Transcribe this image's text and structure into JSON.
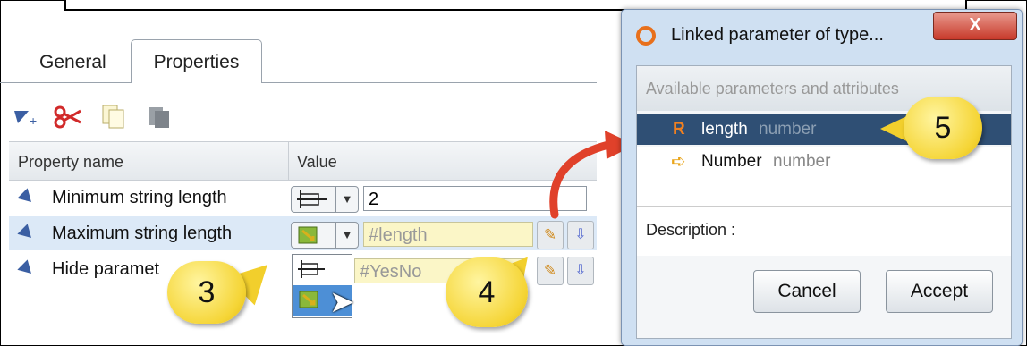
{
  "tabs": [
    {
      "label": "General"
    },
    {
      "label": "Properties"
    }
  ],
  "table": {
    "header_name": "Property name",
    "header_value": "Value",
    "rows": [
      {
        "name": "Minimum string length",
        "value": "2"
      },
      {
        "name": "Maximum string length",
        "value": "#length"
      },
      {
        "name": "Hide paramet",
        "value": "#YesNo"
      }
    ]
  },
  "callouts": {
    "three": "3",
    "four": "4",
    "five": "5"
  },
  "dialog": {
    "title": "Linked parameter of type...",
    "close_label": "X",
    "list_header": "Available parameters and attributes",
    "items": [
      {
        "name": "length",
        "type": "number",
        "icon": "attribute-icon"
      },
      {
        "name": "Number",
        "type": "number",
        "icon": "parameter-arrow-icon"
      }
    ],
    "description_label": "Description :",
    "cancel_label": "Cancel",
    "accept_label": "Accept"
  },
  "colors": {
    "selected_row": "#dce9f7",
    "dialog_selection": "#2f4f74",
    "linked_value_bg": "#fbf6c7",
    "callout_yellow": "#f5d536",
    "arrow_red": "#e0412a"
  }
}
